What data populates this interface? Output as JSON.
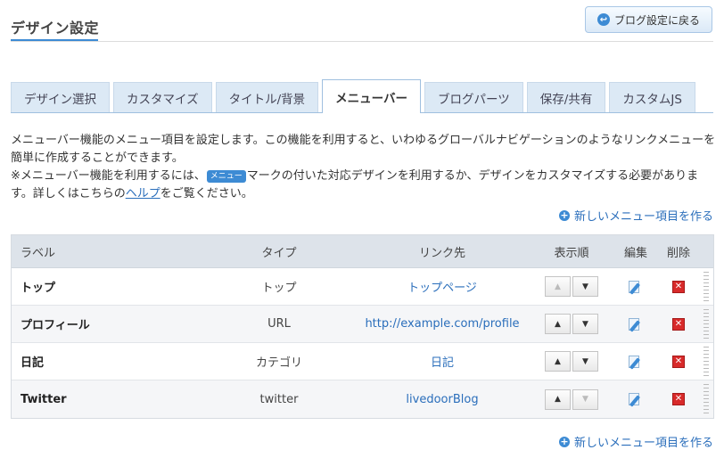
{
  "header": {
    "title": "デザイン設定",
    "back_button": "ブログ設定に戻る"
  },
  "tabs": [
    {
      "label": "デザイン選択",
      "active": false
    },
    {
      "label": "カスタマイズ",
      "active": false
    },
    {
      "label": "タイトル/背景",
      "active": false
    },
    {
      "label": "メニューバー",
      "active": true
    },
    {
      "label": "ブログパーツ",
      "active": false
    },
    {
      "label": "保存/共有",
      "active": false
    },
    {
      "label": "カスタムJS",
      "active": false
    }
  ],
  "description": {
    "line1": "メニューバー機能のメニュー項目を設定します。この機能を利用すると、いわゆるグローバルナビゲーションのようなリンクメニューを簡単に作成することができます。",
    "note_prefix": "※メニューバー機能を利用するには、",
    "badge": "メニュー",
    "note_middle": "マークの付いた対応デザインを利用するか、デザインをカスタマイズする必要があります。詳しくはこちらの",
    "help_link": "ヘルプ",
    "note_suffix": "をご覧ください。"
  },
  "new_item_link": "新しいメニュー項目を作る",
  "table": {
    "headers": {
      "label": "ラベル",
      "type": "タイプ",
      "link": "リンク先",
      "order": "表示順",
      "edit": "編集",
      "delete": "削除"
    },
    "rows": [
      {
        "label": "トップ",
        "type": "トップ",
        "link": "トップページ"
      },
      {
        "label": "プロフィール",
        "type": "URL",
        "link": "http://example.com/profile"
      },
      {
        "label": "日記",
        "type": "カテゴリ",
        "link": "日記"
      },
      {
        "label": "Twitter",
        "type": "twitter",
        "link": "livedoorBlog"
      }
    ]
  },
  "icons": {
    "back": "back-arrow-icon",
    "add": "plus-circle-icon",
    "up": "arrow-up-icon",
    "down": "arrow-down-icon",
    "edit": "edit-icon",
    "delete": "delete-icon"
  },
  "colors": {
    "accent": "#3d8bd4",
    "link": "#2a6ebb",
    "delete": "#d82a2a",
    "tab_bg": "#dce9f5"
  }
}
